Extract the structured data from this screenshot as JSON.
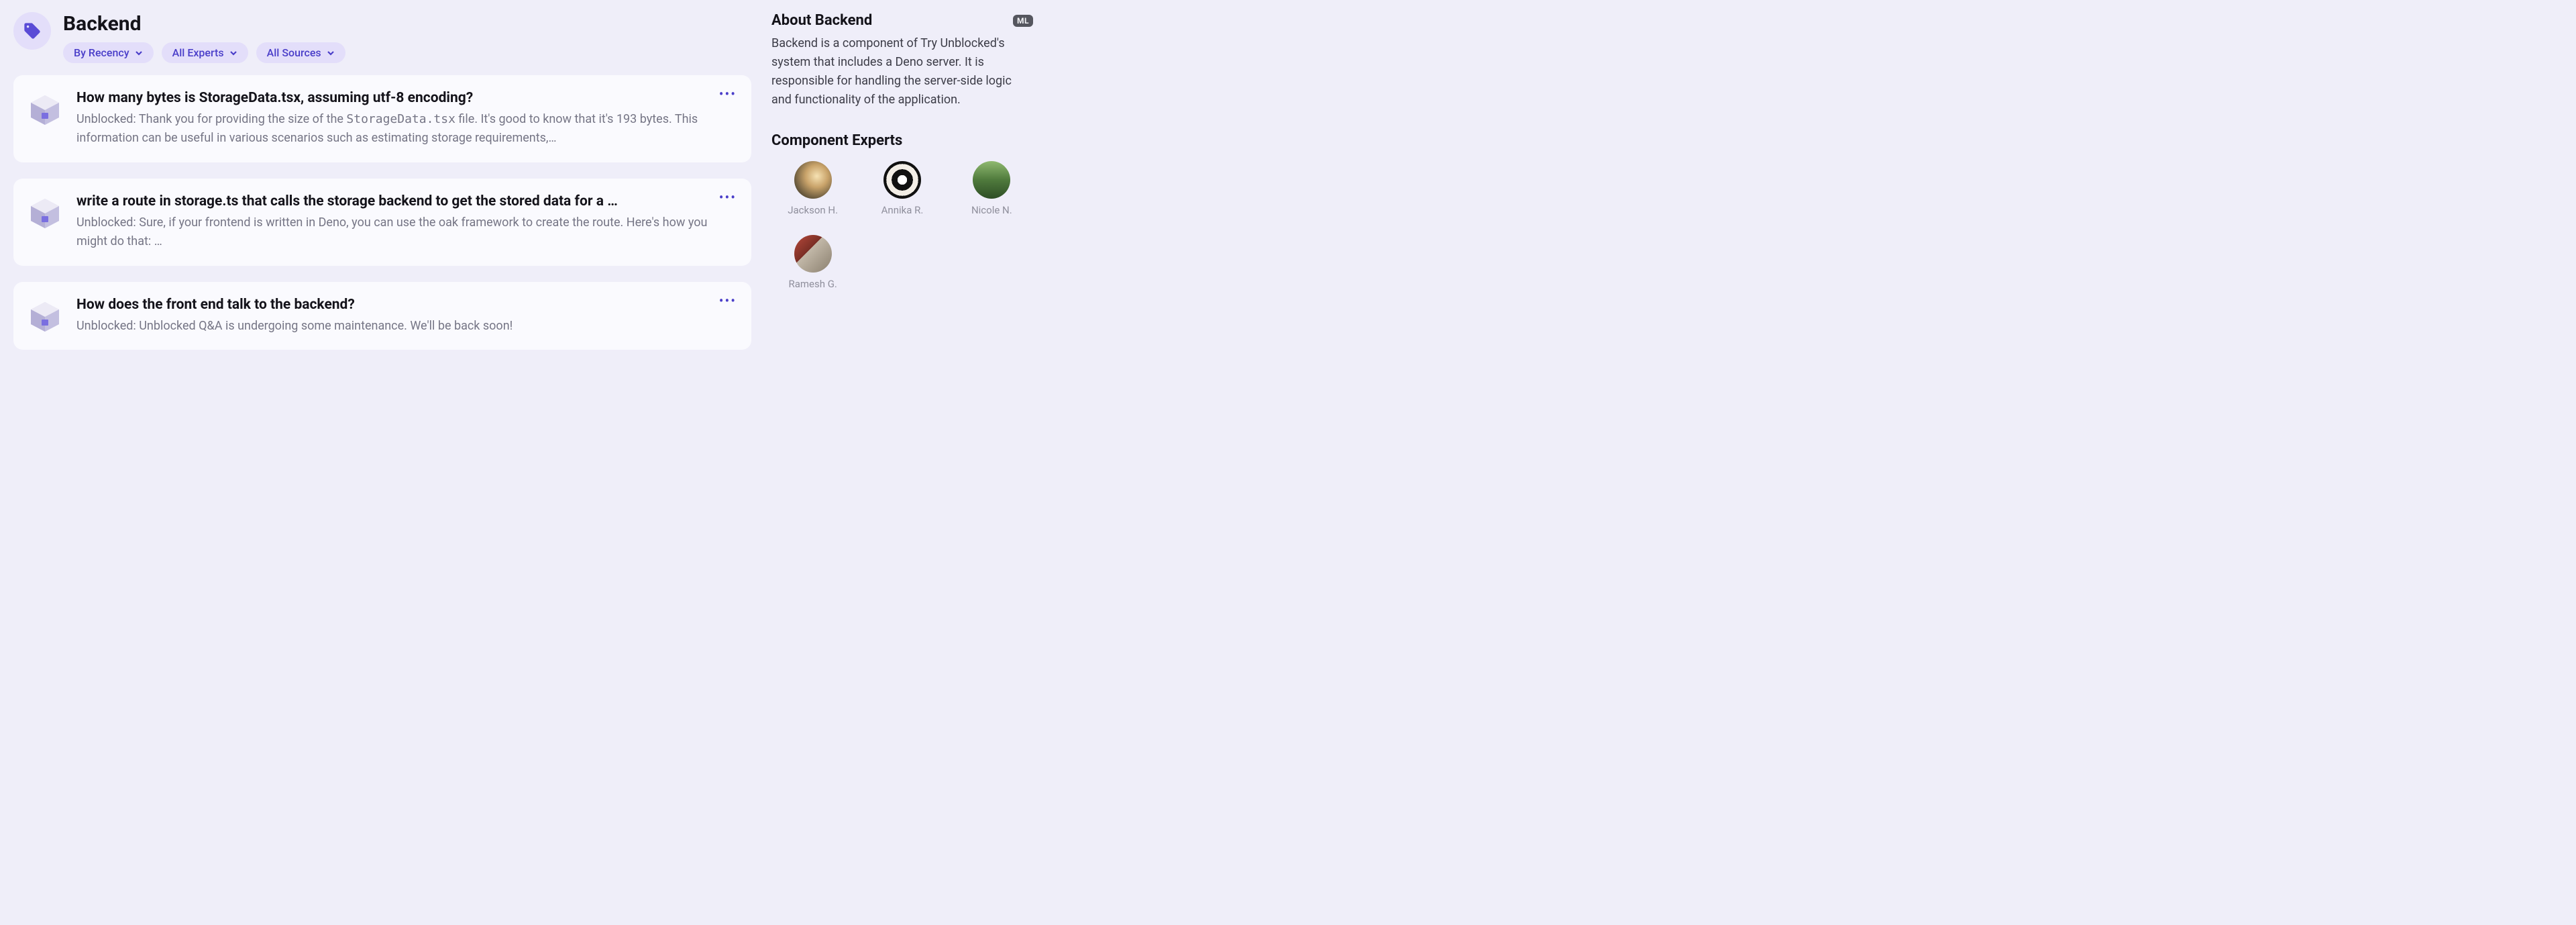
{
  "header": {
    "title": "Backend",
    "filters": [
      {
        "label": "By Recency"
      },
      {
        "label": "All Experts"
      },
      {
        "label": "All Sources"
      }
    ]
  },
  "cards": [
    {
      "title": "How many bytes is StorageData.tsx, assuming utf-8 encoding?",
      "prefix": "Unblocked:",
      "snippet_a": " Thank you for providing the size of the ",
      "code": "StorageData.tsx",
      "snippet_b": " file. It's good to know that it's 193 bytes. This information can be useful in various scenarios such as estimating storage requirements,…"
    },
    {
      "title": "write a route in storage.ts that calls the storage backend to get the stored data for a …",
      "prefix": "Unblocked:",
      "snippet_a": " Sure, if your frontend is written in Deno, you can use the oak framework to create the route. Here's how you might do that: …",
      "code": "",
      "snippet_b": ""
    },
    {
      "title": "How does the front end talk to the backend?",
      "prefix": "Unblocked:",
      "snippet_a": " Unblocked Q&A is undergoing some maintenance. We'll be back soon!",
      "code": "",
      "snippet_b": ""
    }
  ],
  "sidebar": {
    "about_title": "About Backend",
    "ml_badge": "ML",
    "about_text": "Backend is a component of Try Unblocked's system that includes a Deno server. It is responsible for handling the server-side logic and functionality of the application.",
    "experts_title": "Component Experts",
    "experts": [
      {
        "name": "Jackson H."
      },
      {
        "name": "Annika R."
      },
      {
        "name": "Nicole N."
      },
      {
        "name": "Ramesh G."
      }
    ]
  }
}
